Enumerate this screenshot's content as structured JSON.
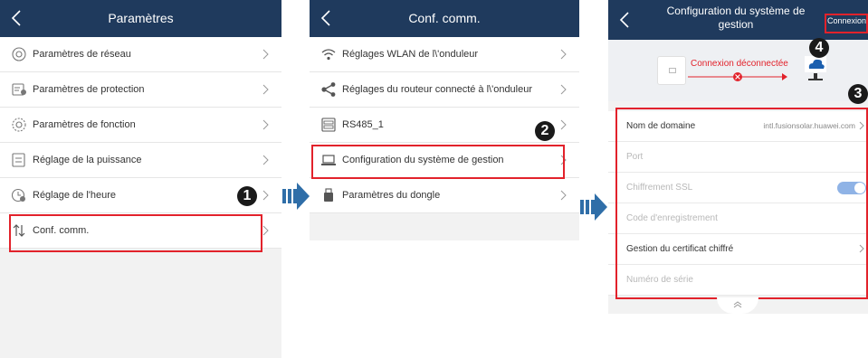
{
  "panel1": {
    "title": "Paramètres",
    "items": [
      {
        "label": "Paramètres de réseau",
        "icon": "network-settings-icon"
      },
      {
        "label": "Paramètres de protection",
        "icon": "protection-settings-icon"
      },
      {
        "label": "Paramètres de fonction",
        "icon": "function-settings-icon"
      },
      {
        "label": "Réglage de la puissance",
        "icon": "power-adjust-icon"
      },
      {
        "label": "Réglage de l'heure",
        "icon": "time-settings-icon"
      },
      {
        "label": "Conf. comm.",
        "icon": "comm-config-icon"
      }
    ],
    "badge": "1"
  },
  "panel2": {
    "title": "Conf. comm.",
    "items": [
      {
        "label": "Réglages WLAN de l\\'onduleur",
        "icon": "wifi-icon"
      },
      {
        "label": "Réglages du routeur connecté à l\\'onduleur",
        "icon": "share-icon"
      },
      {
        "label": "RS485_1",
        "icon": "rs485-icon"
      },
      {
        "label": "Configuration du système de gestion",
        "icon": "laptop-icon"
      },
      {
        "label": "Paramètres du dongle",
        "icon": "dongle-icon"
      }
    ],
    "badge": "2"
  },
  "panel3": {
    "title_line1": "Configuration du système de",
    "title_line2": "gestion",
    "connect_label": "Connexion",
    "status": "Connexion déconnectée",
    "rows": [
      {
        "label": "Nom de domaine",
        "value": "intl.fusionsolar.huawei.com"
      },
      {
        "label": "Port",
        "value": ""
      },
      {
        "label": "Chiffrement SSL",
        "value": ""
      },
      {
        "label": "Code d'enregistrement",
        "value": ""
      },
      {
        "label": "Gestion du certificat chiffré",
        "value": ""
      },
      {
        "label": "Numéro de série",
        "value": ""
      }
    ],
    "ssl_toggle": "on",
    "badge3": "3",
    "badge4": "4"
  },
  "colors": {
    "header": "#1f3a5d",
    "accent": "#e2222b",
    "arrow": "#2f6ea8",
    "toggle": "#5b8fd6"
  }
}
